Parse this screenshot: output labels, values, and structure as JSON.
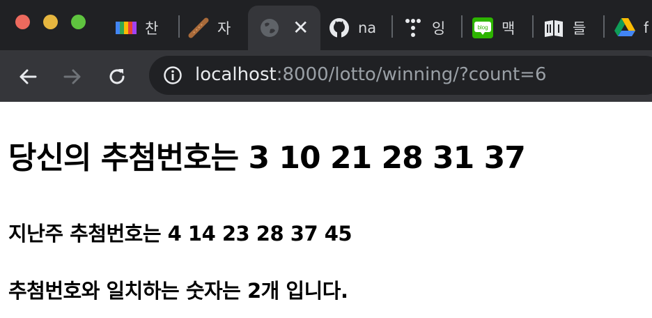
{
  "tabs": [
    {
      "title": "찬",
      "icon": "rainbow-bar-icon",
      "active": false
    },
    {
      "title": "자",
      "icon": "brush-icon",
      "active": false
    },
    {
      "title": "",
      "icon": "globe-icon",
      "active": true
    },
    {
      "title": "na",
      "icon": "github-icon",
      "active": false
    },
    {
      "title": "잉",
      "icon": "dots-icon",
      "active": false
    },
    {
      "title": "맥",
      "icon": "blog-icon",
      "active": false
    },
    {
      "title": "들",
      "icon": "book-icon",
      "active": false
    },
    {
      "title": "f",
      "icon": "drive-icon",
      "active": false
    }
  ],
  "blog_icon_text": "blog",
  "address_bar": {
    "host": "localhost",
    "path": ":8000/lotto/winning/?count=6"
  },
  "content": {
    "heading": "당신의 추첨번호는 3 10 21 28 31 37",
    "last_week": "지난주 추첨번호는 4 14 23 28 37 45",
    "match_result": "추첨번호와 일치하는 숫자는 2개 입니다."
  },
  "colors": {
    "tab_strip": "#202124",
    "toolbar": "#35363a",
    "omnibox": "#202124",
    "close_red": "#ed6a5e",
    "minimize_yellow": "#e6b63f",
    "zoom_green": "#5fc43f"
  }
}
